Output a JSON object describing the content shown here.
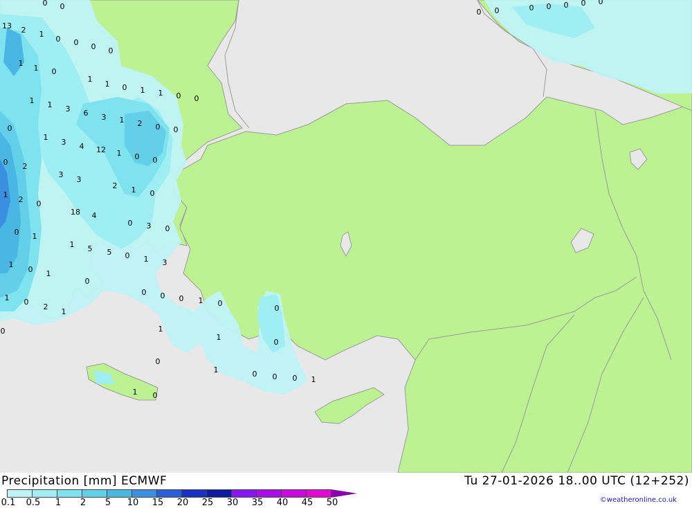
{
  "header": {
    "title": "Precipitation [mm] ECMWF",
    "datetime": "Tu 27-01-2026 18..00 UTC (12+252)",
    "credit": "©weatheronline.co.uk"
  },
  "colors": {
    "land": "#bdf293",
    "sea": "#e8e8e8",
    "border": "#9a9a9a"
  },
  "legend": {
    "labels": [
      "0.1",
      "0.5",
      "1",
      "2",
      "5",
      "10",
      "15",
      "20",
      "25",
      "30",
      "35",
      "40",
      "45",
      "50"
    ],
    "colors": [
      "#bff3f7",
      "#9eeef4",
      "#7fe2ef",
      "#63cfe8",
      "#4ab6e3",
      "#3b8fe0",
      "#2a5fd8",
      "#1b2fc4",
      "#0e1aa0",
      "#8a14f0",
      "#a80fe6",
      "#c80bdc",
      "#e00ad2",
      "#b808a8"
    ]
  },
  "map_values": [
    "0",
    "0",
    "13",
    "2",
    "1",
    "0",
    "0",
    "0",
    "0",
    "1",
    "1",
    "0",
    "1",
    "1",
    "0",
    "1",
    "1",
    "0",
    "0",
    "1",
    "1",
    "3",
    "6",
    "3",
    "1",
    "2",
    "0",
    "0",
    "0",
    "1",
    "3",
    "4",
    "12",
    "1",
    "0",
    "0",
    "0",
    "2",
    "3",
    "3",
    "2",
    "1",
    "0",
    "1",
    "2",
    "0",
    "18",
    "4",
    "0",
    "3",
    "0",
    "0",
    "1",
    "1",
    "5",
    "5",
    "0",
    "1",
    "3",
    "1",
    "0",
    "1",
    "0",
    "0",
    "0",
    "0",
    "1",
    "0",
    "1",
    "0",
    "2",
    "1",
    "0",
    "0",
    "1",
    "1",
    "0",
    "0",
    "1",
    "0",
    "0",
    "0",
    "1",
    "1",
    "0",
    "0",
    "0",
    "0",
    "0",
    "0",
    "0",
    "0"
  ]
}
